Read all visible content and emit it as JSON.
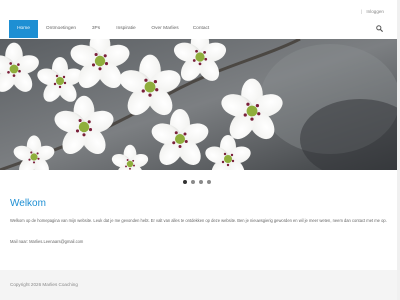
{
  "topbar": {
    "separator": "|",
    "login_label": "Inloggen"
  },
  "nav": {
    "items": [
      {
        "label": "Home"
      },
      {
        "label": "Ontmoetingen"
      },
      {
        "label": "3Ps"
      },
      {
        "label": "Inspiratie"
      },
      {
        "label": "Over Marlies"
      },
      {
        "label": "Contact"
      }
    ],
    "active": "Home",
    "search_icon": "search-icon"
  },
  "slider": {
    "slide_count": 4,
    "active_slide": 1
  },
  "content": {
    "title": "Welkom",
    "intro": "Welkom op de homepagina van mijn website. Leuk dat je me gevonden hebt. Er valt van alles te ontdekken op deze website. Ben je nieuwsgierig geworden en wil je meer weten, neem dan contact met me op.",
    "mail": "Mail naar: Marlies.Leenaars@gmail.com"
  },
  "footer": {
    "copyright": "Copyright 2026 Marlies Coaching"
  },
  "colors": {
    "accent": "#1e8fd3",
    "footer_bg": "#f4f4f4",
    "heading": "#1e8fd3"
  }
}
